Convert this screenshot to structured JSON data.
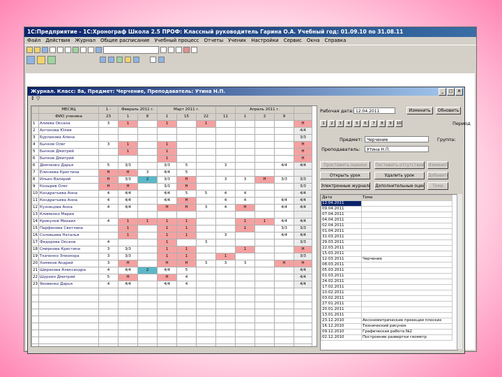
{
  "app": {
    "title": "1С:Предприятие - 1С:Хронограф Школа 2.5 ПРОФ: Классный руководитель Гарина О.А. Учебный год: 01.09.10 по 31.08.11",
    "menu": [
      "Файл",
      "Действия",
      "Журнал",
      "Общее расписание",
      "Учебный процесс",
      "Отчеты",
      "Ученик",
      "Настройки",
      "Сервис",
      "Окна",
      "Справка"
    ]
  },
  "journal": {
    "window_title": "Журнал. Класс: 8а, Предмет: Черчение, Преподаватель: Утина Н.П.",
    "toolbar_text": "↕ ▽",
    "header_row1": [
      "МЕСЯЦ",
      "1 -",
      "Февраль 2011 г.",
      "Март 2011 г.",
      "",
      "Апрель 2011 г.",
      ""
    ],
    "header_row2": [
      "",
      "23",
      "1",
      "8",
      "1",
      "15",
      "22",
      "11",
      "1",
      "2",
      "9"
    ],
    "header_corner": "ФИО ученика",
    "students": [
      {
        "num": "1",
        "name": "Алиева Оксана",
        "m": [
          "3",
          "1",
          "",
          "1",
          "",
          "1",
          "",
          "",
          "",
          ""
        ],
        "avg": "Н"
      },
      {
        "num": "2",
        "name": "Антонова Юлия",
        "m": [
          "",
          "",
          "",
          "",
          "",
          "",
          "",
          "",
          "",
          ""
        ],
        "avg": "4/4"
      },
      {
        "num": "3",
        "name": "Бурлакова Алена",
        "m": [
          "",
          "",
          "",
          "",
          "",
          "",
          "",
          "",
          "",
          ""
        ],
        "avg": "3/3"
      },
      {
        "num": "4",
        "name": "Бычков Олег",
        "m": [
          "3",
          "1",
          "",
          "1",
          "",
          "",
          "",
          "",
          "",
          ""
        ],
        "avg": "Н"
      },
      {
        "num": "5",
        "name": "Бычков Дмитрий",
        "m": [
          "",
          "1",
          "",
          "1",
          "",
          "",
          "",
          "",
          "",
          ""
        ],
        "avg": "Н"
      },
      {
        "num": "6",
        "name": "Бычков Дмитрий",
        "m": [
          "",
          "",
          "",
          "1",
          "",
          "",
          "",
          "",
          "",
          ""
        ],
        "avg": "Н"
      },
      {
        "num": "6",
        "name": "Демченко Дарья",
        "m": [
          "5",
          "3/3",
          "",
          "3/3",
          "5",
          "",
          "3",
          "",
          "",
          "4/4"
        ],
        "avg": "4/4"
      },
      {
        "num": "7",
        "name": "Елисеева Кристина",
        "m": [
          "Н",
          "Н",
          "3",
          "4/4",
          "5",
          "",
          "",
          "",
          "",
          ""
        ],
        "avg": ""
      },
      {
        "num": "8",
        "name": "Ильин Валерий",
        "m": [
          "Н",
          "3/3",
          "2",
          "3/3",
          "Н",
          "",
          "3",
          "3",
          "Н",
          "3/3"
        ],
        "avg": "3/3"
      },
      {
        "num": "9",
        "name": "Козырев Олег",
        "m": [
          "Н",
          "Н",
          "",
          "3/3",
          "Н",
          "",
          "",
          "",
          "",
          ""
        ],
        "avg": "3/3"
      },
      {
        "num": "10",
        "name": "Кондратьева Анна",
        "m": [
          "4",
          "4/4",
          "",
          "4/4",
          "5",
          "5",
          "4",
          "4",
          "",
          ""
        ],
        "avg": "4/4"
      },
      {
        "num": "11",
        "name": "Кондратьева Анна",
        "m": [
          "4",
          "4/4",
          "",
          "4/4",
          "Н",
          "",
          "4",
          "4",
          "",
          "4/4"
        ],
        "avg": "4/4"
      },
      {
        "num": "12",
        "name": "Кузнецова Анна",
        "m": [
          "4",
          "4/4",
          "",
          "Н",
          "Н",
          "3",
          "4",
          "Н",
          "",
          "4/4"
        ],
        "avg": "4/4"
      },
      {
        "num": "13",
        "name": "Клименко Мария",
        "m": [
          "",
          "",
          "",
          "",
          "",
          "",
          "",
          "",
          "",
          ""
        ],
        "avg": ""
      },
      {
        "num": "14",
        "name": "Крикунов Михаил",
        "m": [
          "4",
          "1",
          "1",
          "1",
          "1",
          "",
          "",
          "1",
          "1",
          "4/4"
        ],
        "avg": "4/4"
      },
      {
        "num": "15",
        "name": "Парфенова Светлана",
        "m": [
          "",
          "1",
          "",
          "1",
          "1",
          "",
          "",
          "1",
          "",
          "3/3"
        ],
        "avg": "3/3"
      },
      {
        "num": "16",
        "name": "Соловьева Наталья",
        "m": [
          "",
          "1",
          "",
          "1",
          "1",
          "",
          "3",
          "",
          "",
          "4/4"
        ],
        "avg": "4/4"
      },
      {
        "num": "17",
        "name": "Федорова Оксана",
        "m": [
          "4",
          "",
          "",
          "1",
          "",
          "3",
          "",
          "",
          "",
          ""
        ],
        "avg": "3/3"
      },
      {
        "num": "18",
        "name": "Смирнова Кристина",
        "m": [
          "3",
          "3/3",
          "",
          "1",
          "1",
          "",
          "",
          "1",
          "",
          ""
        ],
        "avg": "Н"
      },
      {
        "num": "19",
        "name": "Ткаченко Элеонора",
        "m": [
          "3",
          "3/3",
          "",
          "1",
          "1",
          "",
          "1",
          "",
          "",
          ""
        ],
        "avg": "3/3"
      },
      {
        "num": "20",
        "name": "Хомяков Андрей",
        "m": [
          "3",
          "Н",
          "",
          "Н",
          "Н",
          "3",
          "3",
          "3",
          "",
          "Н"
        ],
        "avg": "Н"
      },
      {
        "num": "21",
        "name": "Широкова Александра",
        "m": [
          "4",
          "4/4",
          "2",
          "4/4",
          "5",
          "",
          "",
          "",
          "",
          ""
        ],
        "avg": "4/4"
      },
      {
        "num": "22",
        "name": "Шурхин Дмитрий",
        "m": [
          "5",
          "Н",
          "",
          "Н",
          "4",
          "",
          "",
          "",
          "",
          ""
        ],
        "avg": "4/4"
      },
      {
        "num": "23",
        "name": "Яковенко Дарья",
        "m": [
          "4",
          "4/4",
          "",
          "4/4",
          "4",
          "",
          "",
          "",
          "",
          ""
        ],
        "avg": "4/4"
      }
    ]
  },
  "panel": {
    "date_label": "Рабочая дата:",
    "date_value": "12.04.2011",
    "btn_date": "Изменить",
    "btn_update": "Обновить",
    "period_buttons": [
      "1",
      "2",
      "3",
      "4",
      "5",
      "6",
      "7",
      "8",
      "9",
      "10"
    ],
    "next_label": "Период",
    "subject_label": "Предмет:",
    "subject_value": "Черчение",
    "teacher_label": "Преподаватель:",
    "teacher_value": "Утина Н.П.",
    "group_label": "Группа:",
    "buttons": [
      "Проставить оценки",
      "Поставить отсутствие",
      "Изменить",
      "Открыть урок",
      "Удалить урок",
      "Добавить",
      "Электронные журналы",
      "Дополнительные оценки",
      "Тема"
    ],
    "list_headers": [
      "Дата",
      "Тема"
    ],
    "lessons": [
      {
        "date": "12.04.2011",
        "topic": ""
      },
      {
        "date": "09.04.2011",
        "topic": ""
      },
      {
        "date": "07.04.2011",
        "topic": ""
      },
      {
        "date": "04.04.2011",
        "topic": ""
      },
      {
        "date": "02.04.2011",
        "topic": ""
      },
      {
        "date": "01.04.2011",
        "topic": ""
      },
      {
        "date": "31.03.2011",
        "topic": ""
      },
      {
        "date": "29.03.2011",
        "topic": ""
      },
      {
        "date": "22.03.2011",
        "topic": ""
      },
      {
        "date": "15.03.2011",
        "topic": ""
      },
      {
        "date": "12.03.2011",
        "topic": "Черчение"
      },
      {
        "date": "08.03.2011",
        "topic": ""
      },
      {
        "date": "05.03.2011",
        "topic": ""
      },
      {
        "date": "01.03.2011",
        "topic": ""
      },
      {
        "date": "24.02.2011",
        "topic": ""
      },
      {
        "date": "17.02.2011",
        "topic": ""
      },
      {
        "date": "10.02.2011",
        "topic": ""
      },
      {
        "date": "03.02.2011",
        "topic": ""
      },
      {
        "date": "27.01.2011",
        "topic": ""
      },
      {
        "date": "20.01.2011",
        "topic": ""
      },
      {
        "date": "13.01.2011",
        "topic": ""
      },
      {
        "date": "23.12.2010",
        "topic": "Аксонометрические проекции плоских"
      },
      {
        "date": "16.12.2010",
        "topic": "Технический рисунок"
      },
      {
        "date": "09.12.2010",
        "topic": "Графическая работа №2"
      },
      {
        "date": "02.12.2010",
        "topic": "Построение развертки геометр"
      }
    ]
  },
  "colors": {
    "absent": "#f4a1a1",
    "highlight": "#5ab8c8",
    "titlebar": "#0a246a"
  }
}
